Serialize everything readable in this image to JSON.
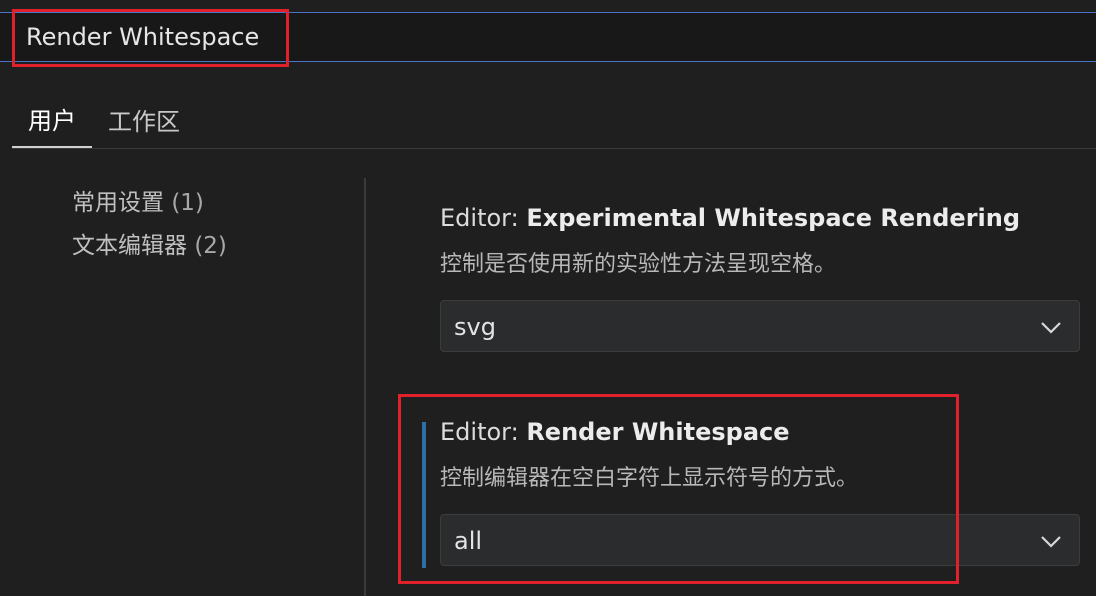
{
  "search": {
    "value": "Render Whitespace"
  },
  "tabs": [
    {
      "label": "用户",
      "active": true
    },
    {
      "label": "工作区",
      "active": false
    }
  ],
  "toc": [
    {
      "label": "常用设置",
      "count": "(1)"
    },
    {
      "label": "文本编辑器",
      "count": "(2)"
    }
  ],
  "settings": [
    {
      "category": "Editor: ",
      "name": "Experimental Whitespace Rendering",
      "description": "控制是否使用新的实验性方法呈现空格。",
      "value": "svg",
      "modified": false
    },
    {
      "category": "Editor: ",
      "name": "Render Whitespace",
      "description": "控制编辑器在空白字符上显示符号的方式。",
      "value": "all",
      "modified": true
    }
  ],
  "colors": {
    "highlight": "#e0212c",
    "modified_indicator": "#2e6fa8",
    "focus_border": "#4a72c8"
  },
  "icons": {
    "dropdown": "chevron-down-icon"
  }
}
